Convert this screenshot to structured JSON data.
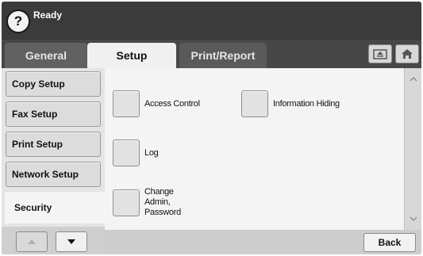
{
  "status": {
    "text": "Ready",
    "help_icon": "question-mark-icon",
    "help_glyph": "?"
  },
  "tabs": [
    {
      "label": "General"
    },
    {
      "label": "Setup"
    },
    {
      "label": "Print/Report"
    }
  ],
  "header_icons": {
    "eject": "eject-icon",
    "home": "home-icon"
  },
  "sidebar": {
    "items": [
      {
        "label": "Copy Setup"
      },
      {
        "label": "Fax Setup"
      },
      {
        "label": "Print Setup"
      },
      {
        "label": "Network Setup"
      },
      {
        "label": "Security"
      }
    ],
    "nav": {
      "up_icon": "triangle-up-icon",
      "down_icon": "triangle-down-icon"
    }
  },
  "options": [
    {
      "label": "Access Control"
    },
    {
      "label": "Information Hiding"
    },
    {
      "label": "Log"
    },
    {
      "label": "Change Admin, Password"
    }
  ],
  "back_label": "Back"
}
